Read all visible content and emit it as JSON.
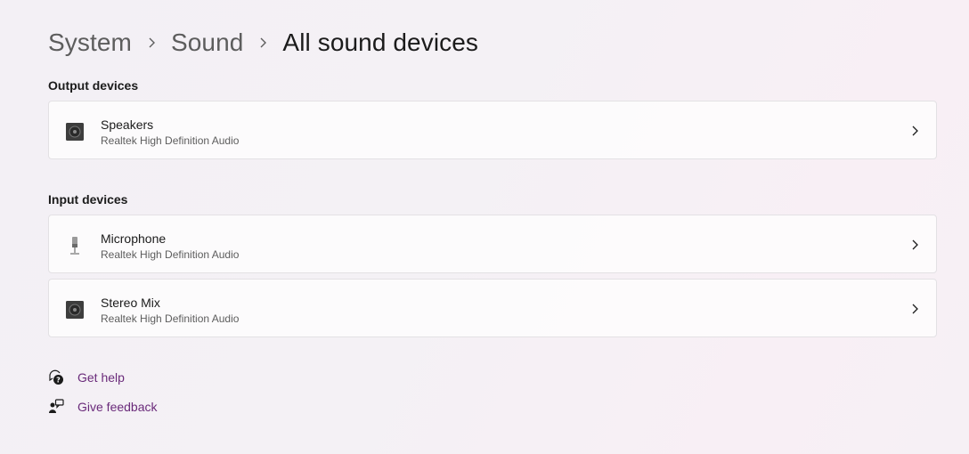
{
  "breadcrumb": {
    "items": [
      "System",
      "Sound"
    ],
    "current": "All sound devices"
  },
  "output": {
    "heading": "Output devices",
    "devices": [
      {
        "name": "Speakers",
        "driver": "Realtek High Definition Audio",
        "icon": "speaker-icon"
      }
    ]
  },
  "input": {
    "heading": "Input devices",
    "devices": [
      {
        "name": "Microphone",
        "driver": "Realtek High Definition Audio",
        "icon": "microphone-icon"
      },
      {
        "name": "Stereo Mix",
        "driver": "Realtek High Definition Audio",
        "icon": "speaker-icon"
      }
    ]
  },
  "links": {
    "help": "Get help",
    "feedback": "Give feedback"
  },
  "colors": {
    "link": "#6a2a7a",
    "secondary_text": "#5d5d5d"
  }
}
